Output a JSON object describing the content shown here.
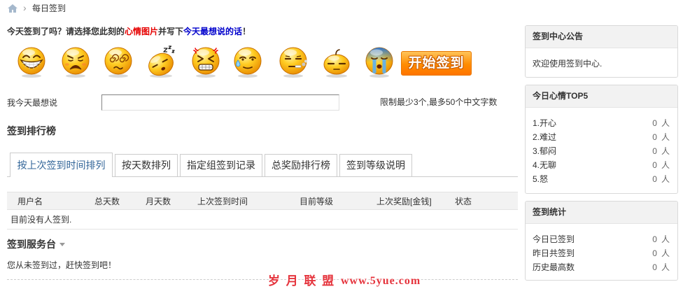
{
  "breadcrumb": {
    "home_icon": "home-icon",
    "separator": "›",
    "current": "每日签到"
  },
  "intro": {
    "text_1": "今天签到了吗？请选择您此刻的",
    "highlight_1": "心情图片",
    "text_2": "并写下",
    "highlight_2": "今天最想说的话",
    "text_3": "！"
  },
  "mood_icons": [
    "mood-happy-icon",
    "mood-sad-icon",
    "mood-dizzy-icon",
    "mood-sleepy-icon",
    "mood-angry-icon",
    "mood-sweat-icon",
    "mood-smoking-icon",
    "mood-lazy-icon",
    "mood-unlucky-icon"
  ],
  "start_button": {
    "label": "开始签到"
  },
  "say": {
    "label": "我今天最想说",
    "value": "",
    "hint": "限制最少3个,最多50个中文字数"
  },
  "ranking": {
    "title": "签到排行榜",
    "tabs": [
      {
        "label": "按上次签到时间排列",
        "active": true
      },
      {
        "label": "按天数排列",
        "active": false
      },
      {
        "label": "指定组签到记录",
        "active": false
      },
      {
        "label": "总奖励排行榜",
        "active": false
      },
      {
        "label": "签到等级说明",
        "active": false
      }
    ],
    "columns": [
      "用户名",
      "总天数",
      "月天数",
      "上次签到时间",
      "目前等级",
      "上次奖励[金钱]",
      "状态"
    ],
    "rows": [],
    "empty_text": "目前没有人签到."
  },
  "service": {
    "title": "签到服务台",
    "message": "您从未签到过，赶快签到吧！"
  },
  "watermark": {
    "name": "岁 月 联 盟",
    "url": "www.5yue.com"
  },
  "sidebar": {
    "notice": {
      "title": "签到中心公告",
      "text": "欢迎使用签到中心."
    },
    "mood_top5": {
      "title": "今日心情TOP5",
      "items": [
        {
          "label": "1.开心",
          "count": "0",
          "unit": "人"
        },
        {
          "label": "2.难过",
          "count": "0",
          "unit": "人"
        },
        {
          "label": "3.郁闷",
          "count": "0",
          "unit": "人"
        },
        {
          "label": "4.无聊",
          "count": "0",
          "unit": "人"
        },
        {
          "label": "5.怒",
          "count": "0",
          "unit": "人"
        }
      ]
    },
    "stats": {
      "title": "签到统计",
      "items": [
        {
          "label": "今日已签到",
          "count": "0",
          "unit": "人"
        },
        {
          "label": "昨日共签到",
          "count": "0",
          "unit": "人"
        },
        {
          "label": "历史最高数",
          "count": "0",
          "unit": "人"
        }
      ]
    }
  },
  "colors": {
    "highlight_red": "#e60000",
    "highlight_blue": "#0000cc",
    "active_tab_text": "#336699",
    "button_orange": "#ff8c00",
    "watermark_red": "#e5343d"
  }
}
